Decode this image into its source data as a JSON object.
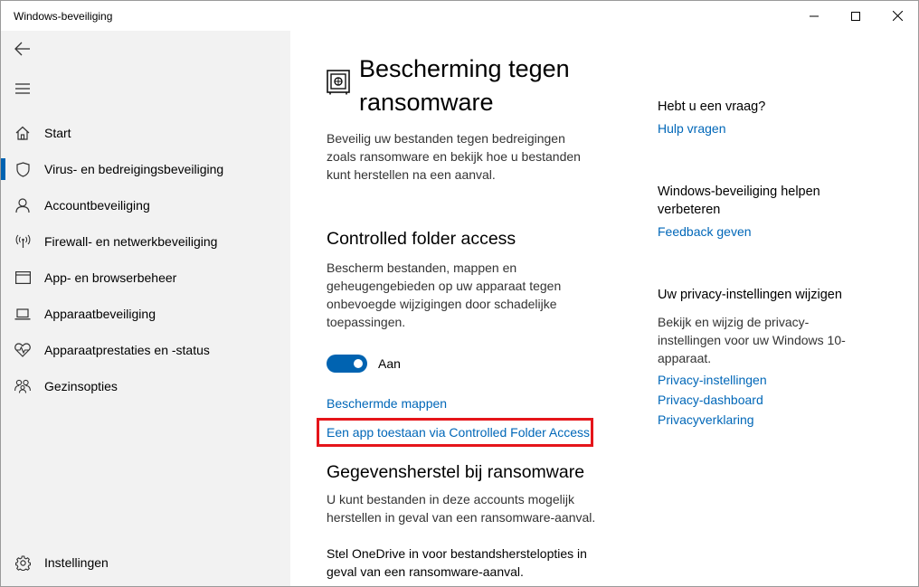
{
  "window": {
    "title": "Windows-beveiliging",
    "controls": {
      "minimize": "minimize-icon",
      "maximize": "maximize-icon",
      "close": "close-icon"
    }
  },
  "sidebar": {
    "back_icon": "back-arrow-icon",
    "menu_icon": "hamburger-icon",
    "items": [
      {
        "label": "Start",
        "icon": "home-icon"
      },
      {
        "label": "Virus- en bedreigingsbeveiliging",
        "icon": "shield-icon",
        "selected": true
      },
      {
        "label": "Accountbeveiliging",
        "icon": "person-icon"
      },
      {
        "label": "Firewall- en netwerkbeveiliging",
        "icon": "antenna-icon"
      },
      {
        "label": "App- en browserbeheer",
        "icon": "app-window-icon"
      },
      {
        "label": "Apparaatbeveiliging",
        "icon": "laptop-icon"
      },
      {
        "label": "Apparaatprestaties en -status",
        "icon": "heart-pulse-icon"
      },
      {
        "label": "Gezinsopties",
        "icon": "family-icon"
      }
    ],
    "settings": {
      "label": "Instellingen",
      "icon": "gear-icon"
    },
    "accent": "#0063b1"
  },
  "main": {
    "page_icon": "ransomware-vault-icon",
    "title_line1": "Bescherming tegen",
    "title_line2": "ransomware",
    "intro_lines": [
      "Beveilig uw bestanden tegen bedreigingen",
      "zoals ransomware en bekijk hoe u bestanden",
      "kunt herstellen na een aanval."
    ],
    "cfa": {
      "heading": "Controlled folder access",
      "desc_lines": [
        "Bescherm bestanden, mappen en",
        "geheugengebieden op uw apparaat tegen",
        "onbevoegde wijzigingen door schadelijke",
        "toepassingen."
      ],
      "toggle_state": "on",
      "toggle_label": "Aan",
      "link_protected_folders": "Beschermde mappen",
      "link_allow_app": "Een app toestaan via Controlled Folder Access",
      "highlight_color": "#e5151a"
    },
    "recovery": {
      "heading": "Gegevensherstel bij ransomware",
      "desc_lines": [
        "U kunt bestanden in deze accounts mogelijk",
        "herstellen in geval van een ransomware-aanval."
      ],
      "onedrive_lines": [
        "Stel OneDrive in voor bestandsherstelopties in",
        "geval van een ransomware-aanval."
      ]
    }
  },
  "right": {
    "question": {
      "heading": "Hebt u een vraag?",
      "link": "Hulp vragen"
    },
    "improve": {
      "heading_line1": "Windows-beveiliging helpen",
      "heading_line2": "verbeteren",
      "link": "Feedback geven"
    },
    "privacy": {
      "heading": "Uw privacy-instellingen wijzigen",
      "text_lines": [
        "Bekijk en wijzig de privacy-",
        "instellingen voor uw Windows 10-",
        "apparaat."
      ],
      "links": [
        "Privacy-instellingen",
        "Privacy-dashboard",
        "Privacyverklaring"
      ]
    }
  },
  "colors": {
    "link": "#0067b8",
    "sidebar_bg": "#f2f2f2"
  }
}
